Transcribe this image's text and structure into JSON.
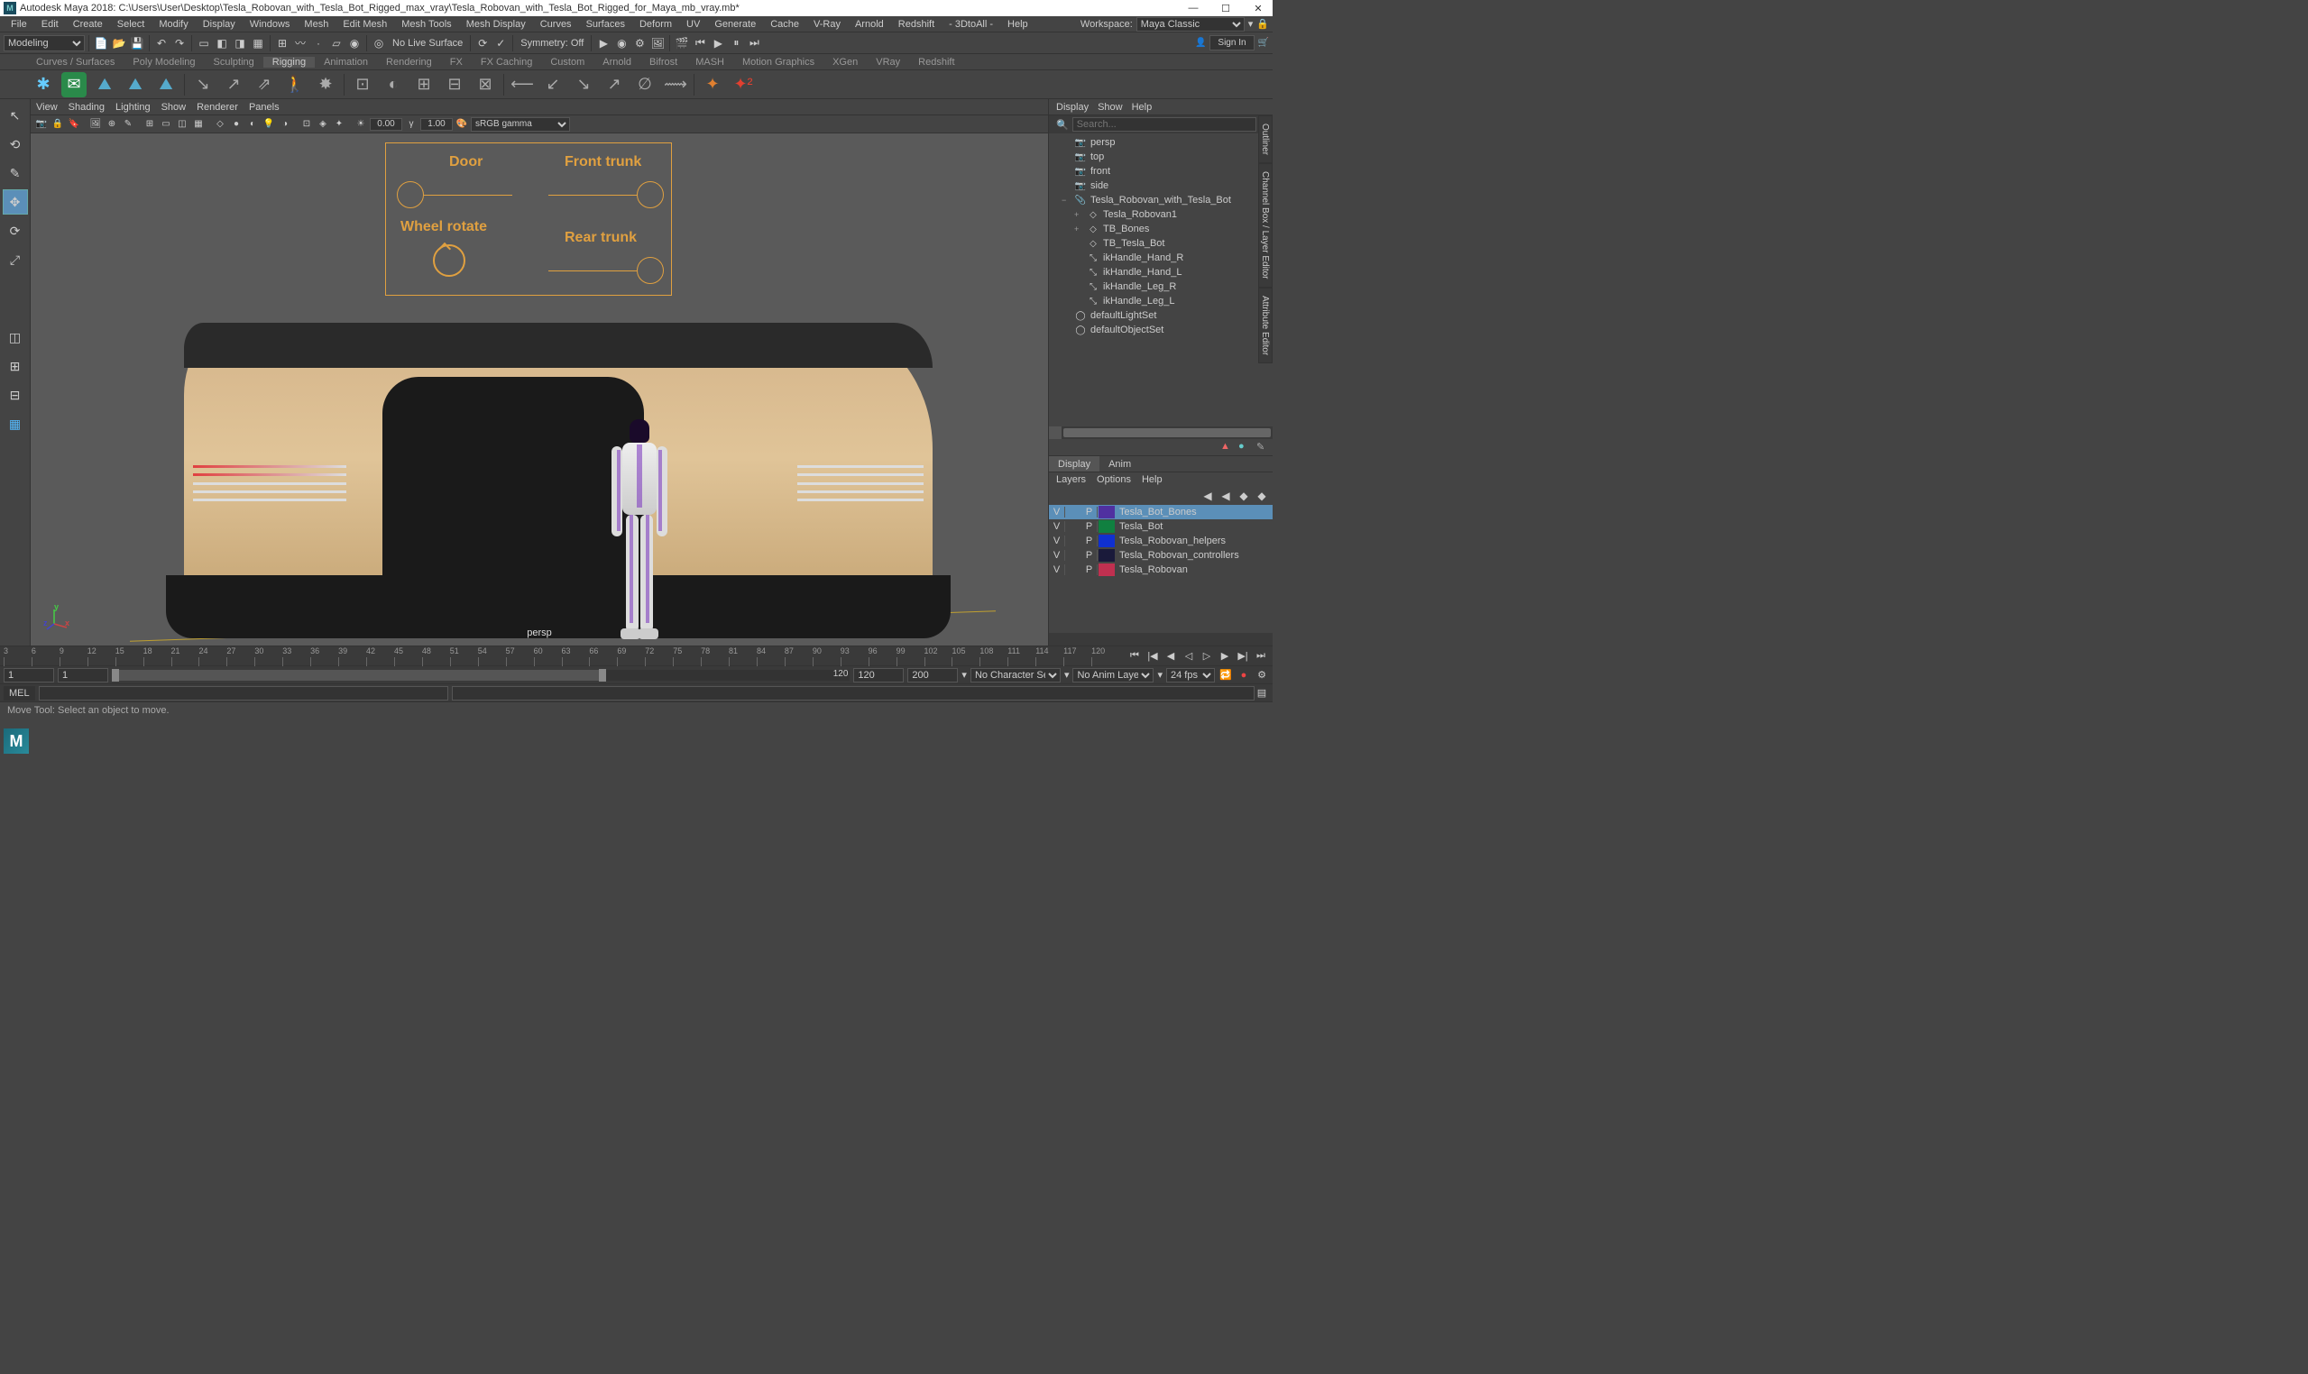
{
  "title": "Autodesk Maya 2018: C:\\Users\\User\\Desktop\\Tesla_Robovan_with_Tesla_Bot_Rigged_max_vray\\Tesla_Robovan_with_Tesla_Bot_Rigged_for_Maya_mb_vray.mb*",
  "menus": [
    "File",
    "Edit",
    "Create",
    "Select",
    "Modify",
    "Display",
    "Windows",
    "Mesh",
    "Edit Mesh",
    "Mesh Tools",
    "Mesh Display",
    "Curves",
    "Surfaces",
    "Deform",
    "UV",
    "Generate",
    "Cache",
    "V-Ray",
    "Arnold",
    "Redshift",
    "- 3DtoAll -",
    "Help"
  ],
  "workspace_label": "Workspace:",
  "workspace_value": "Maya Classic",
  "modeling_dropdown": "Modeling",
  "symmetry_label": "Symmetry: Off",
  "no_live_surface": "No Live Surface",
  "signin": "Sign In",
  "shelf_tabs": [
    "Curves / Surfaces",
    "Poly Modeling",
    "Sculpting",
    "Rigging",
    "Animation",
    "Rendering",
    "FX",
    "FX Caching",
    "Custom",
    "Arnold",
    "Bifrost",
    "MASH",
    "Motion Graphics",
    "XGen",
    "VRay",
    "Redshift"
  ],
  "shelf_active": "Rigging",
  "panel_menus": [
    "View",
    "Shading",
    "Lighting",
    "Show",
    "Renderer",
    "Panels"
  ],
  "exposure": "0.00",
  "gamma": "1.00",
  "color_mgmt": "sRGB gamma",
  "overlay": {
    "door": "Door",
    "front_trunk": "Front trunk",
    "wheel_rotate": "Wheel rotate",
    "rear_trunk": "Rear trunk"
  },
  "persp": "persp",
  "outliner": {
    "menus": [
      "Display",
      "Show",
      "Help"
    ],
    "search_ph": "Search...",
    "items": [
      {
        "name": "persp",
        "icon": "cam",
        "indent": 0,
        "exp": ""
      },
      {
        "name": "top",
        "icon": "cam",
        "indent": 0,
        "exp": ""
      },
      {
        "name": "front",
        "icon": "cam",
        "indent": 0,
        "exp": ""
      },
      {
        "name": "side",
        "icon": "cam",
        "indent": 0,
        "exp": ""
      },
      {
        "name": "Tesla_Robovan_with_Tesla_Bot",
        "icon": "ref",
        "indent": 0,
        "exp": "−"
      },
      {
        "name": "Tesla_Robovan1",
        "icon": "grp",
        "indent": 1,
        "exp": "+"
      },
      {
        "name": "TB_Bones",
        "icon": "grp",
        "indent": 1,
        "exp": "+"
      },
      {
        "name": "TB_Tesla_Bot",
        "icon": "grp",
        "indent": 1,
        "exp": ""
      },
      {
        "name": "ikHandle_Hand_R",
        "icon": "ik",
        "indent": 1,
        "exp": ""
      },
      {
        "name": "ikHandle_Hand_L",
        "icon": "ik",
        "indent": 1,
        "exp": ""
      },
      {
        "name": "ikHandle_Leg_R",
        "icon": "ik",
        "indent": 1,
        "exp": ""
      },
      {
        "name": "ikHandle_Leg_L",
        "icon": "ik",
        "indent": 1,
        "exp": ""
      },
      {
        "name": "defaultLightSet",
        "icon": "set",
        "indent": 0,
        "exp": ""
      },
      {
        "name": "defaultObjectSet",
        "icon": "set",
        "indent": 0,
        "exp": ""
      }
    ]
  },
  "layer_tabs": [
    "Display",
    "Anim"
  ],
  "layer_menus": [
    "Layers",
    "Options",
    "Help"
  ],
  "layers": [
    {
      "v": "V",
      "p": "P",
      "color": "#5030a0",
      "name": "Tesla_Bot_Bones",
      "selected": true
    },
    {
      "v": "V",
      "p": "P",
      "color": "#108040",
      "name": "Tesla_Bot",
      "selected": false
    },
    {
      "v": "V",
      "p": "P",
      "color": "#1030d0",
      "name": "Tesla_Robovan_helpers",
      "selected": false
    },
    {
      "v": "V",
      "p": "P",
      "color": "#1a1a3a",
      "name": "Tesla_Robovan_controllers",
      "selected": false
    },
    {
      "v": "V",
      "p": "P",
      "color": "#c03050",
      "name": "Tesla_Robovan",
      "selected": false
    }
  ],
  "side_tabs": [
    "Outliner",
    "Channel Box / Layer Editor",
    "Attribute Editor"
  ],
  "range": {
    "start_outer": "1",
    "start_inner": "1",
    "end_inner": "120",
    "end_outer": "120",
    "end_outer2": "200",
    "char_set": "No Character Set",
    "anim_layer": "No Anim Layer",
    "fps": "24 fps"
  },
  "cmd_lang": "MEL",
  "status": "Move Tool: Select an object to move.",
  "timeline_ticks": [
    "3",
    "6",
    "9",
    "12",
    "15",
    "18",
    "21",
    "24",
    "27",
    "30",
    "33",
    "36",
    "39",
    "42",
    "45",
    "48",
    "51",
    "54",
    "57",
    "60",
    "63",
    "66",
    "69",
    "72",
    "75",
    "78",
    "81",
    "84",
    "87",
    "90",
    "93",
    "96",
    "99",
    "102",
    "105",
    "108",
    "111",
    "114",
    "117",
    "120"
  ]
}
